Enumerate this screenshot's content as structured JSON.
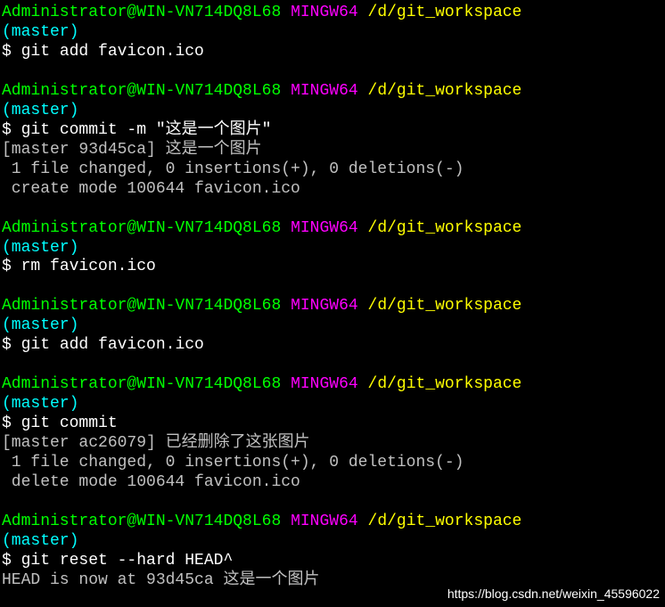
{
  "prompt": {
    "user_host": "Administrator@WIN-VN714DQ8L68",
    "env": "MINGW64",
    "path": "/d/git_workspace",
    "branch_open": "(",
    "branch": "master",
    "branch_close": ")",
    "dollar": "$ "
  },
  "blocks": [
    {
      "cmd": "git add favicon.ico",
      "output": []
    },
    {
      "cmd": "git commit -m \"这是一个图片\"",
      "output": [
        "[master 93d45ca] 这是一个图片",
        " 1 file changed, 0 insertions(+), 0 deletions(-)",
        " create mode 100644 favicon.ico"
      ]
    },
    {
      "cmd": "rm favicon.ico",
      "output": []
    },
    {
      "cmd": "git add favicon.ico",
      "output": []
    },
    {
      "cmd": "git commit",
      "output": [
        "[master ac26079] 已经删除了这张图片",
        " 1 file changed, 0 insertions(+), 0 deletions(-)",
        " delete mode 100644 favicon.ico"
      ]
    },
    {
      "cmd": "git reset --hard HEAD^",
      "output": [
        "HEAD is now at 93d45ca 这是一个图片"
      ]
    }
  ],
  "watermark": "https://blog.csdn.net/weixin_45596022"
}
